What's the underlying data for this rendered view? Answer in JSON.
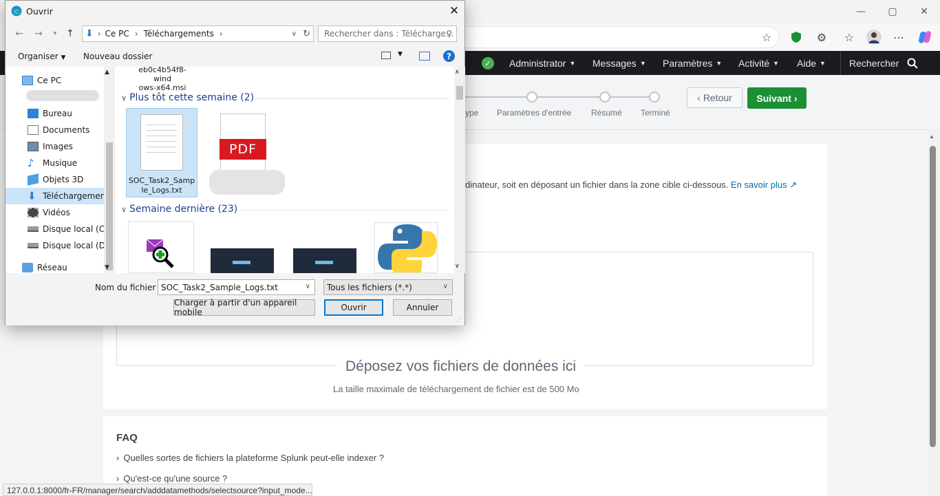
{
  "browser": {
    "window_controls": {
      "minimize": "—",
      "maximize": "▢",
      "close": "✕"
    },
    "toolbar_icons": [
      "star-icon",
      "shield-icon",
      "extensions-icon",
      "favorites-icon",
      "profile-avatar",
      "more-icon",
      "copilot-icon"
    ],
    "status_url": "127.0.0.1:8000/fr-FR/manager/search/adddatamethods/selectsource?input_mode..."
  },
  "splunk_nav": {
    "items": [
      {
        "label": "Administrator"
      },
      {
        "label": "Messages"
      },
      {
        "label": "Paramètres"
      },
      {
        "label": "Activité"
      },
      {
        "label": "Aide"
      }
    ],
    "search_label": "Rechercher",
    "accent_green": "#1a9035"
  },
  "wizard": {
    "steps": [
      "ype",
      "Paramètres d'entrée",
      "Résumé",
      "Terminé"
    ],
    "back_label": "Retour",
    "next_label": "Suivant"
  },
  "upload": {
    "description": "dinateur, soit en déposant un fichier dans la zone cible ci-dessous.",
    "learn_more": "En savoir plus",
    "drop_title": "Déposez vos fichiers de données ici",
    "drop_subtitle": "La taille maximale de téléchargement de fichier est de 500 Mo"
  },
  "faq": {
    "title": "FAQ",
    "items": [
      "Quelles sortes de fichiers la plateforme Splunk peut-elle indexer ?",
      "Qu'est-ce qu'une source ?"
    ]
  },
  "dialog": {
    "title": "Ouvrir",
    "path": [
      "Ce PC",
      "Téléchargements"
    ],
    "search_placeholder": "Rechercher dans : Télécharge...",
    "toolbar": {
      "organize": "Organiser",
      "new_folder": "Nouveau dossier"
    },
    "tree": [
      {
        "label": "Ce PC",
        "icon": "pc-icon"
      },
      {
        "label": "",
        "icon": "folder-icon"
      },
      {
        "label": "Bureau",
        "icon": "desktop-icon"
      },
      {
        "label": "Documents",
        "icon": "documents-icon"
      },
      {
        "label": "Images",
        "icon": "images-icon"
      },
      {
        "label": "Musique",
        "icon": "music-icon"
      },
      {
        "label": "Objets 3D",
        "icon": "objects3d-icon"
      },
      {
        "label": "Téléchargements",
        "icon": "downloads-icon"
      },
      {
        "label": "Vidéos",
        "icon": "videos-icon"
      },
      {
        "label": "Disque local (C:)",
        "icon": "drive-icon"
      },
      {
        "label": "Disque local (D:)",
        "icon": "drive-icon"
      },
      {
        "label": "Réseau",
        "icon": "network-icon"
      }
    ],
    "top_file_line1": "eb0c4b54f8-wind",
    "top_file_line2": "ows-x64.msi",
    "groups": [
      {
        "label": "Plus tôt cette semaine (2)"
      },
      {
        "label": "Semaine dernière (23)"
      }
    ],
    "files": [
      {
        "name_line1": "SOC_Task2_Samp",
        "name_line2": "le_Logs.txt",
        "icon": "text-file-icon"
      },
      {
        "name_line1": "",
        "name_line2": "",
        "icon": "pdf-file-icon",
        "badge": "PDF"
      }
    ],
    "filename_label": "Nom du fichier :",
    "filename_value": "SOC_Task2_Sample_Logs.txt",
    "filetype_value": "Tous les fichiers (*.*)",
    "mobile_button": "Charger à partir d'un appareil mobile",
    "open_button": "Ouvrir",
    "cancel_button": "Annuler"
  }
}
